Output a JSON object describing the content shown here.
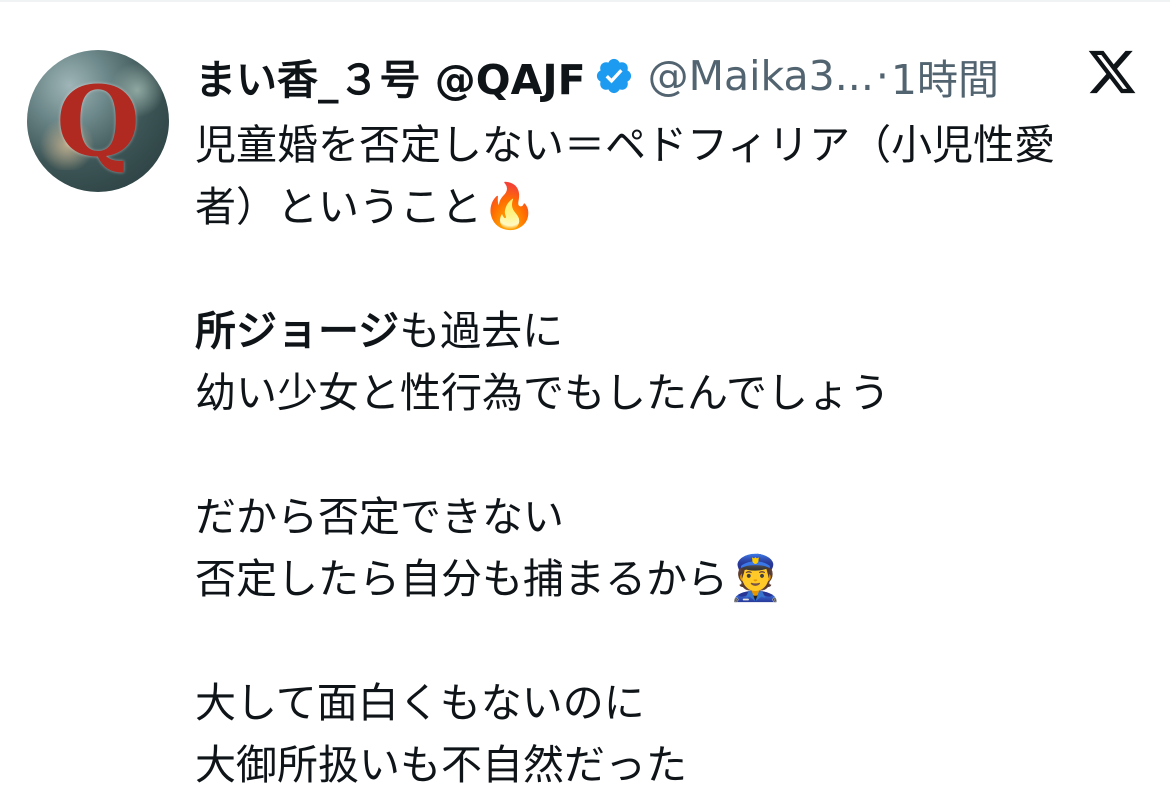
{
  "header": {
    "display_name": "まい香_３号 @QAJF",
    "handle": "@Maika3...",
    "separator": "·",
    "timestamp": "1時間"
  },
  "icons": {
    "verified": "verified-badge-icon",
    "platform": "x-logo-icon",
    "accent": "#1d9bf0"
  },
  "tweet": {
    "line1": "児童婚を否定しない＝ペドフィリア（小児性愛",
    "line2_text": "者）ということ",
    "line2_emoji": "🔥",
    "line3_bold": "所ジョージ",
    "line3_rest": "も過去に",
    "line4": "幼い少女と性行為でもしたんでしょう",
    "line5": "だから否定できない",
    "line6_text": "否定したら自分も捕まるから",
    "line6_emoji": "👮",
    "line7": "大して面白くもないのに",
    "line8": "大御所扱いも不自然だった"
  }
}
